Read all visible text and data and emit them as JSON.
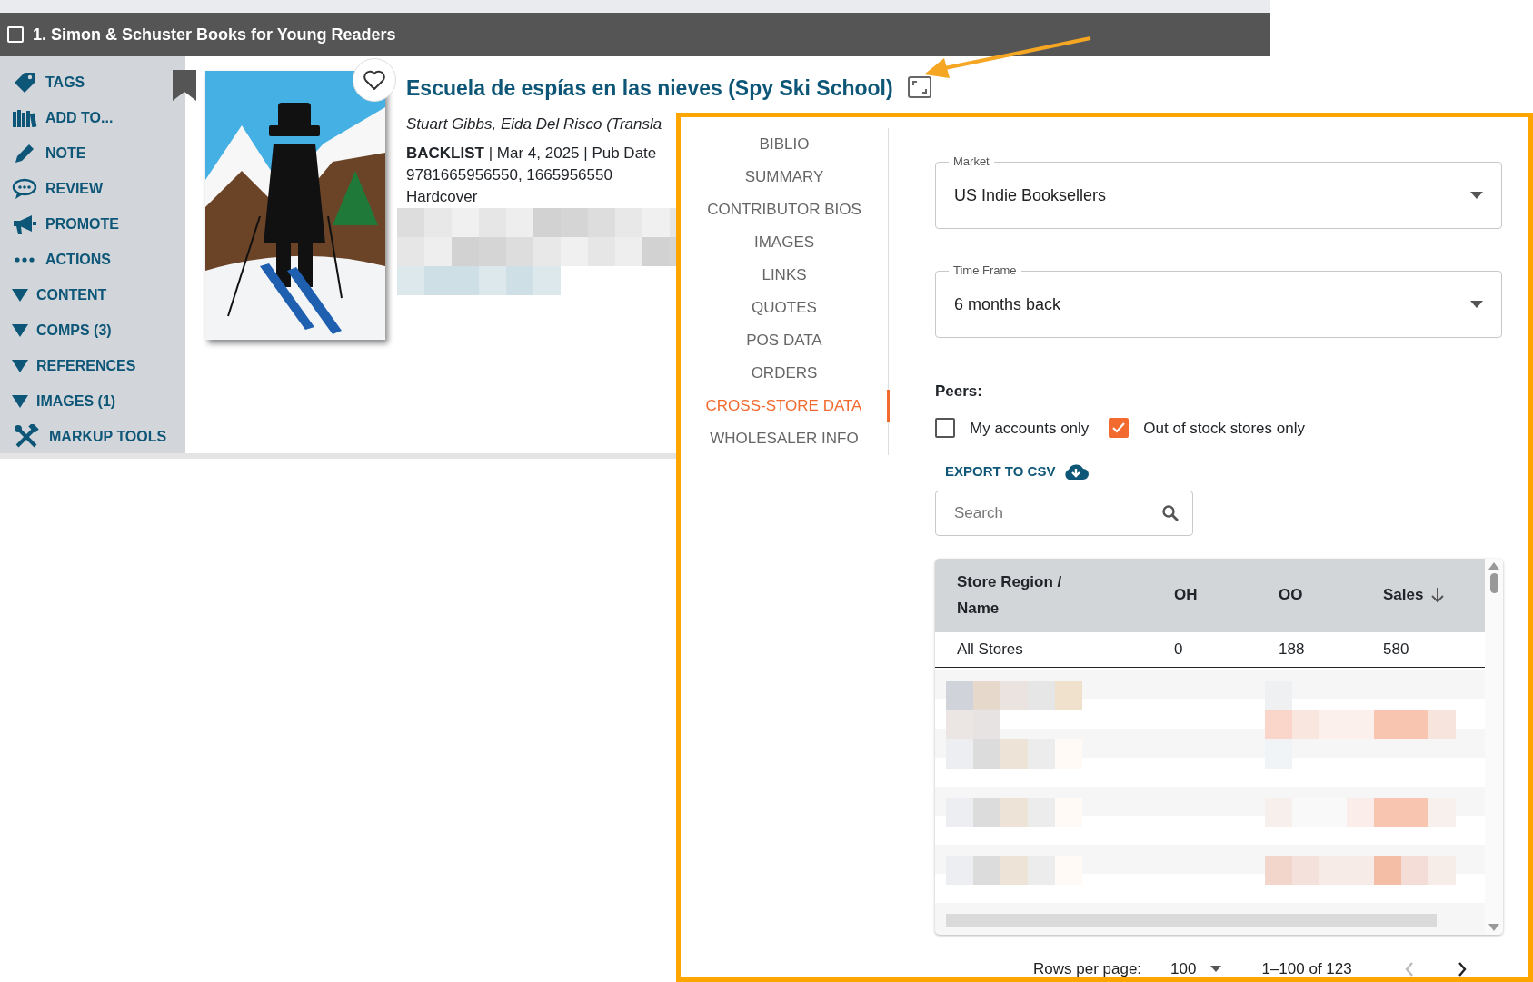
{
  "header": {
    "title": "1. Simon & Schuster Books for Young Readers",
    "checked": false
  },
  "sidebar": {
    "items": [
      {
        "label": "TAGS",
        "kind": "action"
      },
      {
        "label": "ADD TO...",
        "kind": "action"
      },
      {
        "label": "NOTE",
        "kind": "action"
      },
      {
        "label": "REVIEW",
        "kind": "action"
      },
      {
        "label": "PROMOTE",
        "kind": "action"
      },
      {
        "label": "ACTIONS",
        "kind": "action"
      },
      {
        "label": "CONTENT",
        "kind": "section"
      },
      {
        "label": "COMPS (3)",
        "kind": "section"
      },
      {
        "label": "REFERENCES",
        "kind": "section"
      },
      {
        "label": "IMAGES (1)",
        "kind": "section"
      },
      {
        "label": "MARKUP TOOLS",
        "kind": "action"
      }
    ]
  },
  "book": {
    "title": "Escuela de espías en las nieves (Spy Ski School)",
    "author": "Stuart Gibbs, Eida Del Risco (Transla",
    "status": "BACKLIST",
    "meta": "| Mar 4, 2025 | Pub Date",
    "isbns": "9781665956550, 1665956550",
    "format": "Hardcover",
    "favorite": false
  },
  "panel": {
    "nav": [
      {
        "label": "BIBLIO",
        "selected": false
      },
      {
        "label": "SUMMARY",
        "selected": false
      },
      {
        "label": "CONTRIBUTOR BIOS",
        "selected": false
      },
      {
        "label": "IMAGES",
        "selected": false
      },
      {
        "label": "LINKS",
        "selected": false
      },
      {
        "label": "QUOTES",
        "selected": false
      },
      {
        "label": "POS DATA",
        "selected": false
      },
      {
        "label": "ORDERS",
        "selected": false
      },
      {
        "label": "CROSS-STORE DATA",
        "selected": true
      },
      {
        "label": "WHOLESALER INFO",
        "selected": false
      }
    ],
    "market": {
      "label": "Market",
      "value": "US Indie Booksellers"
    },
    "time_frame": {
      "label": "Time Frame",
      "value": "6 months back"
    },
    "peers": {
      "label": "Peers:",
      "options": [
        {
          "label": "My accounts only",
          "checked": false
        },
        {
          "label": "Out of stock stores only",
          "checked": true
        }
      ]
    },
    "export": "EXPORT TO CSV",
    "search": {
      "placeholder": "Search"
    },
    "table": {
      "columns": [
        {
          "label": "Store Region / Name",
          "sorted": false
        },
        {
          "label": "OH",
          "sorted": false
        },
        {
          "label": "OO",
          "sorted": false
        },
        {
          "label": "Sales",
          "sorted": true
        }
      ],
      "rows": [
        {
          "cells": [
            "All Stores",
            "0",
            "188",
            "580"
          ]
        }
      ]
    },
    "pagination": {
      "rows_label": "Rows per page:",
      "rows_value": "100",
      "range": "1–100 of 123",
      "prev_disabled": true,
      "next_disabled": false
    }
  }
}
